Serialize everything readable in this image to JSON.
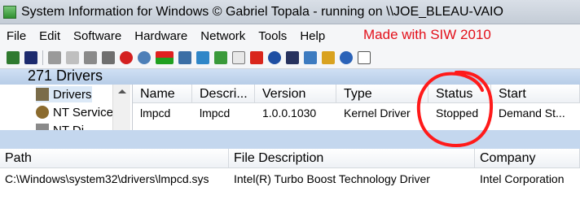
{
  "window": {
    "title": "System Information for Windows  © Gabriel Topala - running on \\\\JOE_BLEAU-VAIO",
    "app_icon": "siw-app-icon"
  },
  "menubar": {
    "items": [
      "File",
      "Edit",
      "Software",
      "Hardware",
      "Network",
      "Tools",
      "Help"
    ],
    "brand_text": "Made with SIW 2010",
    "brand_color": "#e3101a"
  },
  "toolbar": {
    "icons": [
      "exit-icon",
      "save-icon",
      "cut-icon",
      "copy-icon",
      "paste-icon",
      "print-icon",
      "stop-icon",
      "find-icon",
      "color-bar-icon",
      "chart-icon",
      "network-icon",
      "refresh-icon",
      "document-icon",
      "power-icon",
      "globe-icon",
      "shield-icon",
      "monitor-icon",
      "gallery-icon",
      "help-icon",
      "cup-icon"
    ]
  },
  "count_bar": {
    "text": "271 Drivers"
  },
  "tree": {
    "items": [
      {
        "label": "Drivers",
        "icon": "drivers-icon"
      },
      {
        "label": "NT Services",
        "icon": "services-gear-icon"
      },
      {
        "label": "NT Di",
        "icon": "disk-icon"
      }
    ]
  },
  "drivers_table": {
    "columns": [
      "Name",
      "Descri...",
      "Version",
      "Type",
      "Status",
      "Start"
    ],
    "rows": [
      [
        "lmpcd",
        "lmpcd",
        "1.0.0.1030",
        "Kernel Driver",
        "Stopped",
        "Demand St..."
      ]
    ]
  },
  "details_table": {
    "columns": [
      "Path",
      "File Description",
      "Company"
    ],
    "rows": [
      [
        "C:\\Windows\\system32\\drivers\\lmpcd.sys",
        "Intel(R) Turbo Boost Technology Driver",
        "Intel Corporation"
      ]
    ]
  },
  "annotation": {
    "color": "#ff1a1a"
  }
}
